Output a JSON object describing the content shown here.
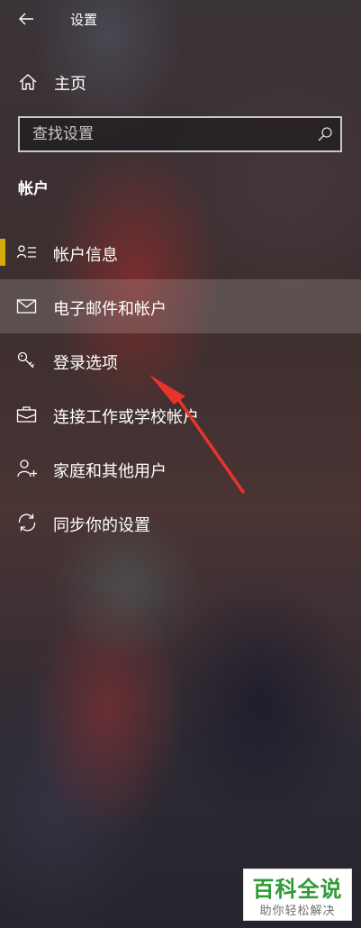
{
  "window": {
    "title": "设置",
    "back_icon": "arrow-left-icon"
  },
  "home": {
    "label": "主页",
    "icon": "home-icon"
  },
  "search": {
    "placeholder": "查找设置",
    "value": "",
    "icon": "search-icon"
  },
  "section": {
    "title": "帐户"
  },
  "nav": {
    "items": [
      {
        "label": "帐户信息",
        "icon": "person-card-icon",
        "selected": true
      },
      {
        "label": "电子邮件和帐户",
        "icon": "mail-icon",
        "hovered": true
      },
      {
        "label": "登录选项",
        "icon": "key-icon"
      },
      {
        "label": "连接工作或学校帐户",
        "icon": "briefcase-icon"
      },
      {
        "label": "家庭和其他用户",
        "icon": "person-add-icon"
      },
      {
        "label": "同步你的设置",
        "icon": "sync-icon"
      }
    ]
  },
  "watermark": {
    "main": "百科全说",
    "sub": "助你轻松解决"
  },
  "colors": {
    "selection_indicator": "#d4a90c",
    "annotation_arrow": "#e8332e",
    "watermark_green": "#2f9b33"
  }
}
